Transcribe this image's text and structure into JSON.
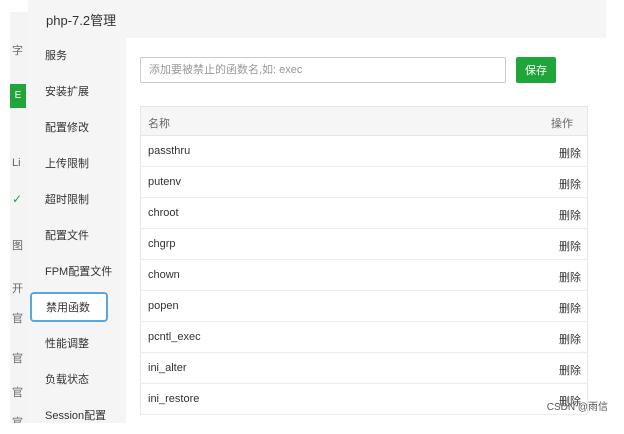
{
  "background_fragments": [
    "字",
    "E",
    "Li",
    "✓",
    "图",
    "开",
    "官",
    "官",
    "官",
    "官"
  ],
  "dialog": {
    "title": "php-7.2管理"
  },
  "nav": {
    "items": [
      {
        "label": "服务"
      },
      {
        "label": "安装扩展"
      },
      {
        "label": "配置修改"
      },
      {
        "label": "上传限制"
      },
      {
        "label": "超时限制"
      },
      {
        "label": "配置文件"
      },
      {
        "label": "FPM配置文件"
      },
      {
        "label": "禁用函数"
      },
      {
        "label": "性能调整"
      },
      {
        "label": "负载状态"
      },
      {
        "label": "Session配置"
      }
    ],
    "active_index": 7
  },
  "form": {
    "input_placeholder": "添加要被禁止的函数名,如: exec",
    "input_value": "",
    "save_label": "保存"
  },
  "table": {
    "headers": {
      "name": "名称",
      "action": "操作"
    },
    "rows": [
      {
        "name": "passthru",
        "action": "删除"
      },
      {
        "name": "putenv",
        "action": "删除"
      },
      {
        "name": "chroot",
        "action": "删除"
      },
      {
        "name": "chgrp",
        "action": "删除"
      },
      {
        "name": "chown",
        "action": "删除"
      },
      {
        "name": "popen",
        "action": "删除"
      },
      {
        "name": "pcntl_exec",
        "action": "删除"
      },
      {
        "name": "ini_alter",
        "action": "删除"
      },
      {
        "name": "ini_restore",
        "action": "删除"
      }
    ]
  },
  "colors": {
    "accent_green": "#20a53a",
    "active_border": "#5aa7e0"
  },
  "watermark": "CSDN @雨信"
}
